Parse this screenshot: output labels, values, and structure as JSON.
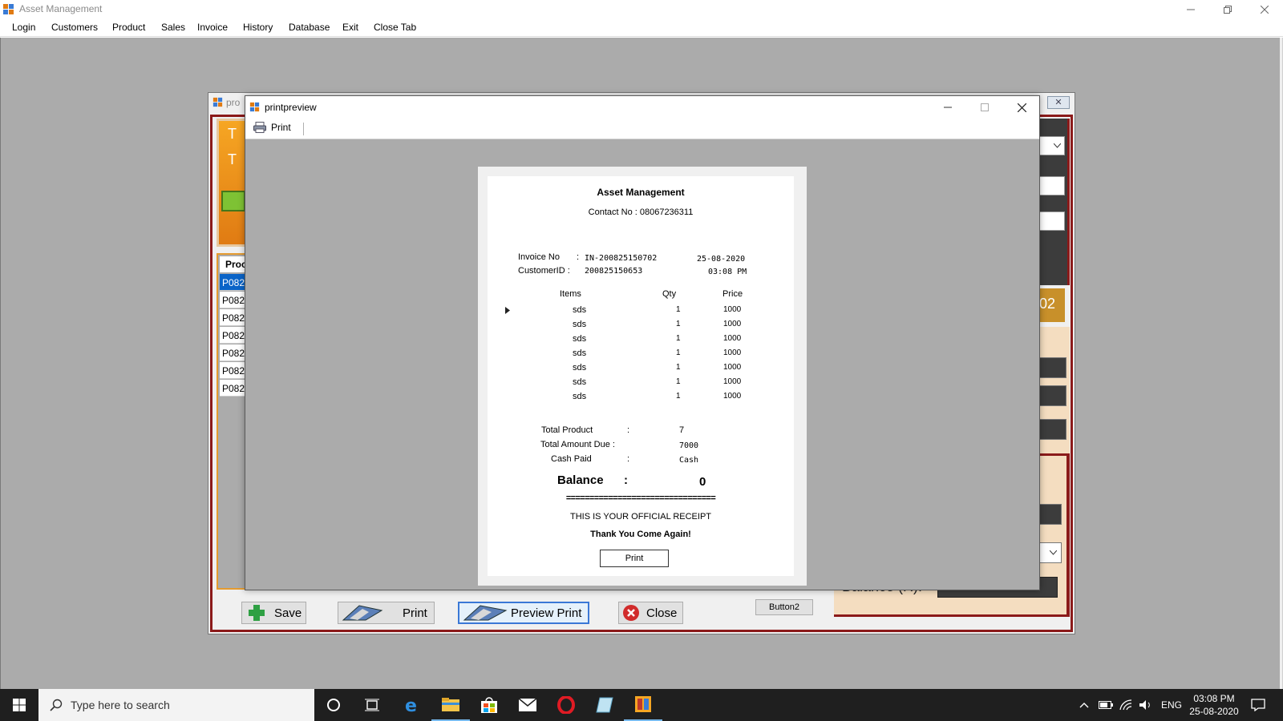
{
  "window": {
    "title": "Asset Management",
    "menu": [
      "Login",
      "Customers",
      "Product",
      "Sales",
      "Invoice",
      "History",
      "Database",
      "Exit",
      "Close Tab"
    ]
  },
  "background_form": {
    "title_fragment": "pro",
    "gold_panel_letters": [
      "T",
      "T"
    ],
    "list_header": "Proc",
    "list_rows": [
      "P082",
      "P082",
      "P082",
      "P082",
      "P082",
      "P082",
      "P082"
    ],
    "right_tab_text": "02",
    "right_label_fragment": "Balance (R):",
    "buttons": {
      "save": "Save",
      "print": "Print",
      "preview_print": "Preview Print",
      "close": "Close",
      "button2": "Button2"
    }
  },
  "print_preview": {
    "title": "printpreview",
    "toolbar_print": "Print",
    "receipt": {
      "company": "Asset Management",
      "contact": "Contact No : 08067236311",
      "invoice_label": "Invoice No",
      "invoice_colon": ":",
      "invoice_value": "IN-200825150702",
      "customer_label": "CustomerID :",
      "customer_value": "200825150653",
      "date": "25-08-2020",
      "time": "03:08 PM",
      "col_items": "Items",
      "col_qty": "Qty",
      "col_price": "Price",
      "rows": [
        {
          "item": "sds",
          "qty": "1",
          "price": "1000"
        },
        {
          "item": "sds",
          "qty": "1",
          "price": "1000"
        },
        {
          "item": "sds",
          "qty": "1",
          "price": "1000"
        },
        {
          "item": "sds",
          "qty": "1",
          "price": "1000"
        },
        {
          "item": "sds",
          "qty": "1",
          "price": "1000"
        },
        {
          "item": "sds",
          "qty": "1",
          "price": "1000"
        },
        {
          "item": "sds",
          "qty": "1",
          "price": "1000"
        }
      ],
      "total_product_label": "Total Product",
      "total_product_colon": ":",
      "total_product_value": "7",
      "total_amount_label": "Total Amount Due :",
      "total_amount_value": "7000",
      "cash_paid_label": "Cash Paid",
      "cash_paid_colon": ":",
      "cash_paid_value": "Cash",
      "balance_label": "Balance",
      "balance_colon": ":",
      "balance_value": "0",
      "separator": "================================",
      "official": "THIS IS YOUR OFFICIAL RECEIPT",
      "thanks": "Thank You Come Again!",
      "print_button": "Print"
    }
  },
  "taskbar": {
    "search_placeholder": "Type here to search",
    "language": "ENG",
    "time": "03:08 PM",
    "date": "25-08-2020"
  }
}
